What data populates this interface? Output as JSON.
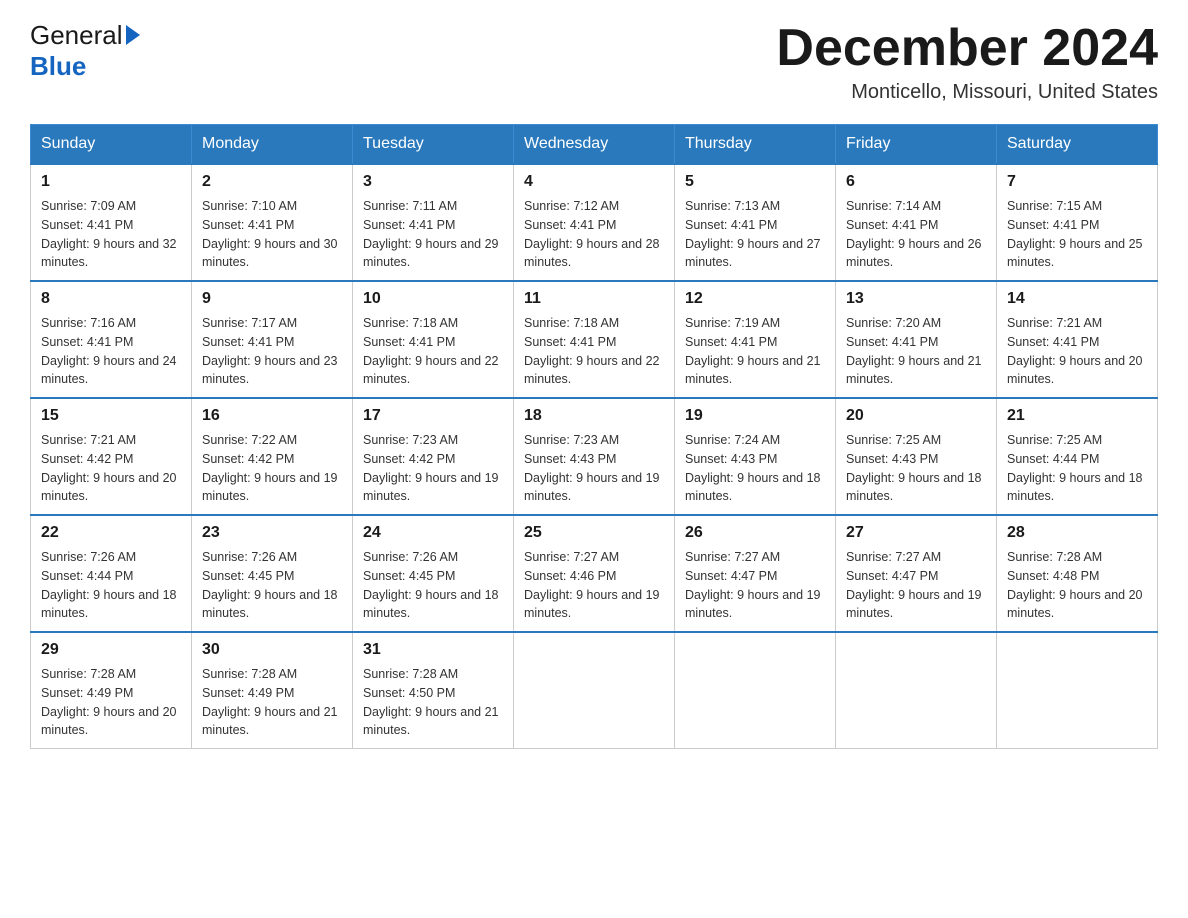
{
  "header": {
    "logo_general": "General",
    "logo_blue": "Blue",
    "month_title": "December 2024",
    "location": "Monticello, Missouri, United States"
  },
  "weekdays": [
    "Sunday",
    "Monday",
    "Tuesday",
    "Wednesday",
    "Thursday",
    "Friday",
    "Saturday"
  ],
  "weeks": [
    [
      {
        "day": "1",
        "sunrise": "7:09 AM",
        "sunset": "4:41 PM",
        "daylight": "9 hours and 32 minutes."
      },
      {
        "day": "2",
        "sunrise": "7:10 AM",
        "sunset": "4:41 PM",
        "daylight": "9 hours and 30 minutes."
      },
      {
        "day": "3",
        "sunrise": "7:11 AM",
        "sunset": "4:41 PM",
        "daylight": "9 hours and 29 minutes."
      },
      {
        "day": "4",
        "sunrise": "7:12 AM",
        "sunset": "4:41 PM",
        "daylight": "9 hours and 28 minutes."
      },
      {
        "day": "5",
        "sunrise": "7:13 AM",
        "sunset": "4:41 PM",
        "daylight": "9 hours and 27 minutes."
      },
      {
        "day": "6",
        "sunrise": "7:14 AM",
        "sunset": "4:41 PM",
        "daylight": "9 hours and 26 minutes."
      },
      {
        "day": "7",
        "sunrise": "7:15 AM",
        "sunset": "4:41 PM",
        "daylight": "9 hours and 25 minutes."
      }
    ],
    [
      {
        "day": "8",
        "sunrise": "7:16 AM",
        "sunset": "4:41 PM",
        "daylight": "9 hours and 24 minutes."
      },
      {
        "day": "9",
        "sunrise": "7:17 AM",
        "sunset": "4:41 PM",
        "daylight": "9 hours and 23 minutes."
      },
      {
        "day": "10",
        "sunrise": "7:18 AM",
        "sunset": "4:41 PM",
        "daylight": "9 hours and 22 minutes."
      },
      {
        "day": "11",
        "sunrise": "7:18 AM",
        "sunset": "4:41 PM",
        "daylight": "9 hours and 22 minutes."
      },
      {
        "day": "12",
        "sunrise": "7:19 AM",
        "sunset": "4:41 PM",
        "daylight": "9 hours and 21 minutes."
      },
      {
        "day": "13",
        "sunrise": "7:20 AM",
        "sunset": "4:41 PM",
        "daylight": "9 hours and 21 minutes."
      },
      {
        "day": "14",
        "sunrise": "7:21 AM",
        "sunset": "4:41 PM",
        "daylight": "9 hours and 20 minutes."
      }
    ],
    [
      {
        "day": "15",
        "sunrise": "7:21 AM",
        "sunset": "4:42 PM",
        "daylight": "9 hours and 20 minutes."
      },
      {
        "day": "16",
        "sunrise": "7:22 AM",
        "sunset": "4:42 PM",
        "daylight": "9 hours and 19 minutes."
      },
      {
        "day": "17",
        "sunrise": "7:23 AM",
        "sunset": "4:42 PM",
        "daylight": "9 hours and 19 minutes."
      },
      {
        "day": "18",
        "sunrise": "7:23 AM",
        "sunset": "4:43 PM",
        "daylight": "9 hours and 19 minutes."
      },
      {
        "day": "19",
        "sunrise": "7:24 AM",
        "sunset": "4:43 PM",
        "daylight": "9 hours and 18 minutes."
      },
      {
        "day": "20",
        "sunrise": "7:25 AM",
        "sunset": "4:43 PM",
        "daylight": "9 hours and 18 minutes."
      },
      {
        "day": "21",
        "sunrise": "7:25 AM",
        "sunset": "4:44 PM",
        "daylight": "9 hours and 18 minutes."
      }
    ],
    [
      {
        "day": "22",
        "sunrise": "7:26 AM",
        "sunset": "4:44 PM",
        "daylight": "9 hours and 18 minutes."
      },
      {
        "day": "23",
        "sunrise": "7:26 AM",
        "sunset": "4:45 PM",
        "daylight": "9 hours and 18 minutes."
      },
      {
        "day": "24",
        "sunrise": "7:26 AM",
        "sunset": "4:45 PM",
        "daylight": "9 hours and 18 minutes."
      },
      {
        "day": "25",
        "sunrise": "7:27 AM",
        "sunset": "4:46 PM",
        "daylight": "9 hours and 19 minutes."
      },
      {
        "day": "26",
        "sunrise": "7:27 AM",
        "sunset": "4:47 PM",
        "daylight": "9 hours and 19 minutes."
      },
      {
        "day": "27",
        "sunrise": "7:27 AM",
        "sunset": "4:47 PM",
        "daylight": "9 hours and 19 minutes."
      },
      {
        "day": "28",
        "sunrise": "7:28 AM",
        "sunset": "4:48 PM",
        "daylight": "9 hours and 20 minutes."
      }
    ],
    [
      {
        "day": "29",
        "sunrise": "7:28 AM",
        "sunset": "4:49 PM",
        "daylight": "9 hours and 20 minutes."
      },
      {
        "day": "30",
        "sunrise": "7:28 AM",
        "sunset": "4:49 PM",
        "daylight": "9 hours and 21 minutes."
      },
      {
        "day": "31",
        "sunrise": "7:28 AM",
        "sunset": "4:50 PM",
        "daylight": "9 hours and 21 minutes."
      },
      null,
      null,
      null,
      null
    ]
  ],
  "labels": {
    "sunrise": "Sunrise: ",
    "sunset": "Sunset: ",
    "daylight": "Daylight: "
  }
}
